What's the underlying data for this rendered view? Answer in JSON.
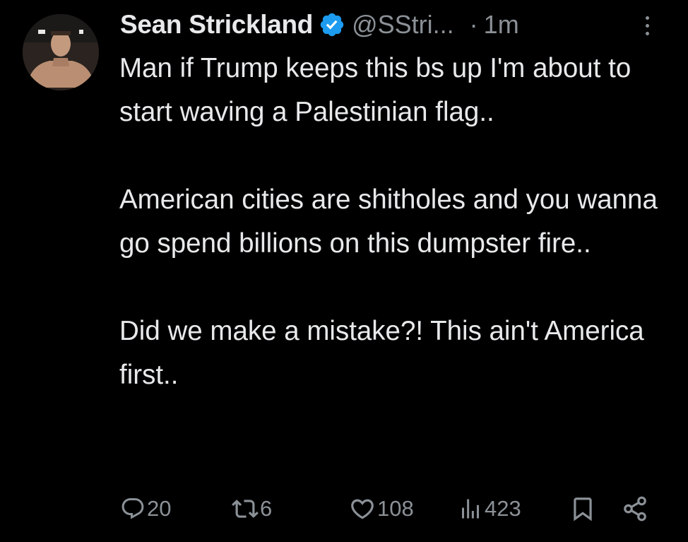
{
  "author": {
    "name": "Sean Strickland",
    "handle": "@SStri...",
    "separator": "·",
    "time": "1m",
    "verified": true,
    "verified_color": "#1d9bf0"
  },
  "tweet": {
    "paragraphs": [
      "Man if Trump keeps this bs up I'm about to start waving a Palestinian flag..",
      "American cities are shitholes and you wanna go spend billions on this dumpster fire..",
      "Did we make a mistake?! This ain't America first.."
    ]
  },
  "actions": {
    "replies": "20",
    "reposts": "6",
    "likes": "108",
    "views": "423"
  },
  "icons": [
    "more-icon",
    "verified-badge-icon",
    "reply-icon",
    "repost-icon",
    "like-icon",
    "views-icon",
    "bookmark-icon",
    "share-icon"
  ]
}
